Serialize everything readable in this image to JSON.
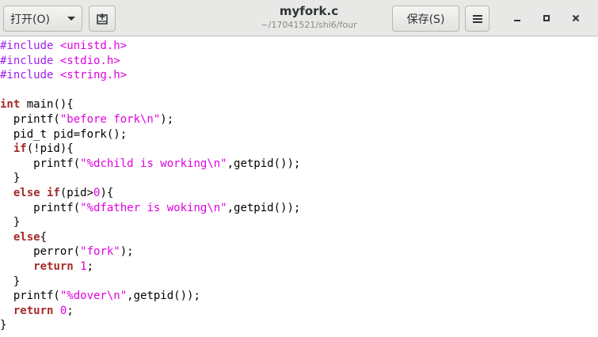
{
  "header": {
    "open_label": "打开(O)",
    "save_label": "保存(S)",
    "title": "myfork.c",
    "subtitle": "~/17041521/shi6/four"
  },
  "colors": {
    "preprocessor": "#a020f0",
    "string": "#e000e0",
    "keyword": "#a52a2a",
    "number": "#e000e0",
    "plain": "#000000"
  },
  "code_lines": [
    [
      {
        "t": "#include ",
        "c": "pre"
      },
      {
        "t": "<unistd.h>",
        "c": "str"
      }
    ],
    [
      {
        "t": "#include ",
        "c": "pre"
      },
      {
        "t": "<stdio.h>",
        "c": "str"
      }
    ],
    [
      {
        "t": "#include ",
        "c": "pre"
      },
      {
        "t": "<string.h>",
        "c": "str"
      }
    ],
    [],
    [
      {
        "t": "int",
        "c": "kw"
      },
      {
        "t": " main(){",
        "c": "plain"
      }
    ],
    [
      {
        "t": "  printf(",
        "c": "plain"
      },
      {
        "t": "\"before fork\\n\"",
        "c": "str"
      },
      {
        "t": ");",
        "c": "plain"
      }
    ],
    [
      {
        "t": "  pid_t pid=fork();",
        "c": "plain"
      }
    ],
    [
      {
        "t": "  ",
        "c": "plain"
      },
      {
        "t": "if",
        "c": "kw"
      },
      {
        "t": "(!pid){",
        "c": "plain"
      }
    ],
    [
      {
        "t": "     printf(",
        "c": "plain"
      },
      {
        "t": "\"%dchild is working\\n\"",
        "c": "str"
      },
      {
        "t": ",getpid());",
        "c": "plain"
      }
    ],
    [
      {
        "t": "  }",
        "c": "plain"
      }
    ],
    [
      {
        "t": "  ",
        "c": "plain"
      },
      {
        "t": "else if",
        "c": "kw"
      },
      {
        "t": "(pid>",
        "c": "plain"
      },
      {
        "t": "0",
        "c": "num"
      },
      {
        "t": "){",
        "c": "plain"
      }
    ],
    [
      {
        "t": "     printf(",
        "c": "plain"
      },
      {
        "t": "\"%dfather is woking\\n\"",
        "c": "str"
      },
      {
        "t": ",getpid());",
        "c": "plain"
      }
    ],
    [
      {
        "t": "  }",
        "c": "plain"
      }
    ],
    [
      {
        "t": "  ",
        "c": "plain"
      },
      {
        "t": "else",
        "c": "kw"
      },
      {
        "t": "{",
        "c": "plain"
      }
    ],
    [
      {
        "t": "     perror(",
        "c": "plain"
      },
      {
        "t": "\"fork\"",
        "c": "str"
      },
      {
        "t": ");",
        "c": "plain"
      }
    ],
    [
      {
        "t": "     ",
        "c": "plain"
      },
      {
        "t": "return",
        "c": "kw"
      },
      {
        "t": " ",
        "c": "plain"
      },
      {
        "t": "1",
        "c": "num"
      },
      {
        "t": ";",
        "c": "plain"
      }
    ],
    [
      {
        "t": "  }",
        "c": "plain"
      }
    ],
    [
      {
        "t": "  printf(",
        "c": "plain"
      },
      {
        "t": "\"%dover\\n\"",
        "c": "str"
      },
      {
        "t": ",getpid());",
        "c": "plain"
      }
    ],
    [
      {
        "t": "  ",
        "c": "plain"
      },
      {
        "t": "return",
        "c": "kw"
      },
      {
        "t": " ",
        "c": "plain"
      },
      {
        "t": "0",
        "c": "num"
      },
      {
        "t": ";",
        "c": "plain"
      }
    ],
    [
      {
        "t": "}",
        "c": "plain"
      }
    ]
  ]
}
